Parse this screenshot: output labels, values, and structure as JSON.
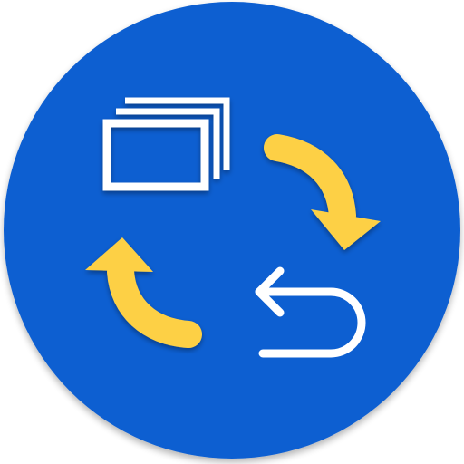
{
  "icon": {
    "shape": "circle",
    "glyphs": [
      "stacked-windows-icon",
      "rotate-clockwise-arrow-icon",
      "rotate-counterclockwise-arrow-icon",
      "undo-return-arrow-icon"
    ]
  },
  "colors": {
    "background": "#0d5fd1",
    "background_shadow": "#0a4aa6",
    "rim_highlight": "#2f78dc",
    "arrow_accent": "#fdd045",
    "arrow_shadow": "#c99d1d",
    "window_stroke": "#ffffff",
    "return_stroke": "#ffffff"
  }
}
